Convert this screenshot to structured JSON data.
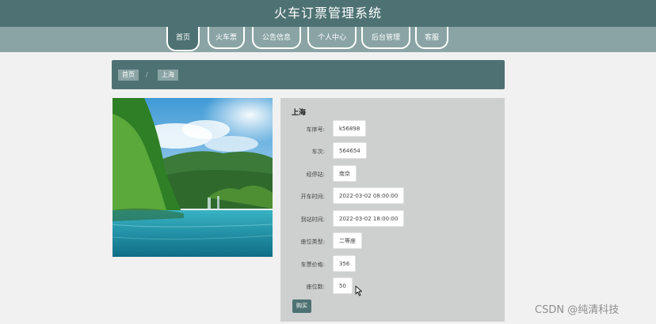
{
  "header": {
    "title": "火车订票管理系统"
  },
  "nav": {
    "items": [
      {
        "label": "首页",
        "active": true
      },
      {
        "label": "火车票",
        "active": false
      },
      {
        "label": "公告信息",
        "active": false
      },
      {
        "label": "个人中心",
        "active": false
      },
      {
        "label": "后台管理",
        "active": false
      },
      {
        "label": "客服",
        "active": false
      }
    ]
  },
  "breadcrumb": {
    "home": "首页",
    "separator": "/",
    "current": "上海"
  },
  "detail": {
    "place": "上海",
    "fields": [
      {
        "label": "车序号:",
        "value": "k56898"
      },
      {
        "label": "车次:",
        "value": "564654"
      },
      {
        "label": "经停站:",
        "value": "南京"
      },
      {
        "label": "开车时间:",
        "value": "2022-03-02 08:00:00"
      },
      {
        "label": "到站时间:",
        "value": "2022-03-02 18:00:00"
      },
      {
        "label": "座位类型:",
        "value": "二等座"
      },
      {
        "label": "车票价格:",
        "value": "356"
      },
      {
        "label": "座位数:",
        "value": "50"
      }
    ],
    "buy_label": "购买"
  },
  "watermark": "CSDN @纯清科技",
  "colors": {
    "primary": "#4e7273",
    "nav_bg": "#8aa4a5",
    "panel_bg": "#cdd0cf",
    "page_bg": "#f1f1f1"
  },
  "icons": {
    "cursor": "mouse-pointer-icon"
  }
}
